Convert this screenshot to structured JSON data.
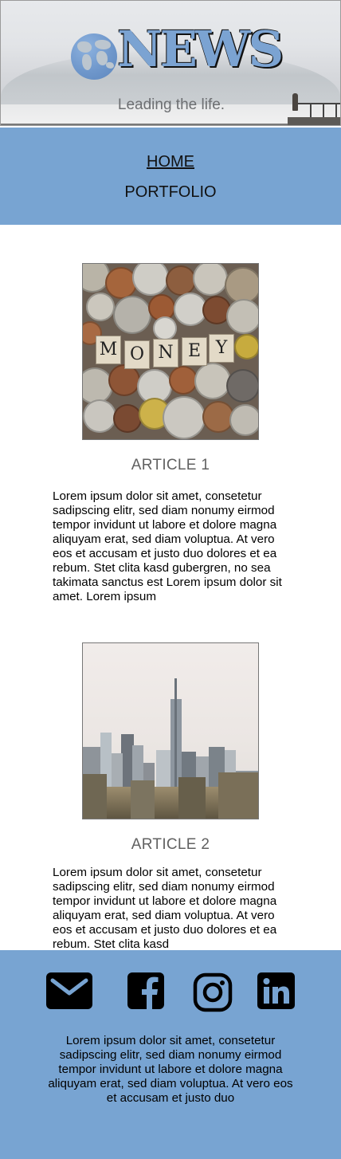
{
  "header": {
    "logo_text": "NEWS",
    "tagline": "Leading the life."
  },
  "nav": {
    "items": [
      {
        "label": "HOME",
        "active": true
      },
      {
        "label": "PORTFOLIO",
        "active": false
      }
    ]
  },
  "articles": [
    {
      "title": "ARTICLE 1",
      "image": "coins-money-photo",
      "image_letters": [
        "M",
        "O",
        "N",
        "E",
        "Y"
      ],
      "body": "Lorem ipsum dolor sit amet, consetetur sadipscing elitr, sed diam nonumy eirmod tempor invidunt ut labore et dolore magna aliquyam erat, sed diam voluptua. At vero eos et accusam et justo duo dolores et ea rebum. Stet clita kasd gubergren, no sea takimata sanctus est Lorem ipsum dolor sit amet. Lorem ipsum"
    },
    {
      "title": "ARTICLE 2",
      "image": "city-skyline-photo",
      "body": "Lorem ipsum dolor sit amet, consetetur sadipscing elitr, sed diam nonumy eirmod tempor invidunt ut labore et dolore magna aliquyam erat, sed diam voluptua. At vero eos et accusam et justo duo dolores et ea rebum. Stet clita kasd"
    }
  ],
  "footer": {
    "social_icons": [
      "mail-icon",
      "facebook-icon",
      "instagram-icon",
      "linkedin-icon"
    ],
    "text": "Lorem ipsum dolor sit amet, consetetur sadipscing elitr, sed diam nonumy eirmod tempor invidunt ut labore et dolore magna aliquyam erat, sed diam voluptua. At vero eos et accusam et justo duo"
  },
  "colors": {
    "accent": "#78a4d2",
    "title_gray": "#616161"
  }
}
